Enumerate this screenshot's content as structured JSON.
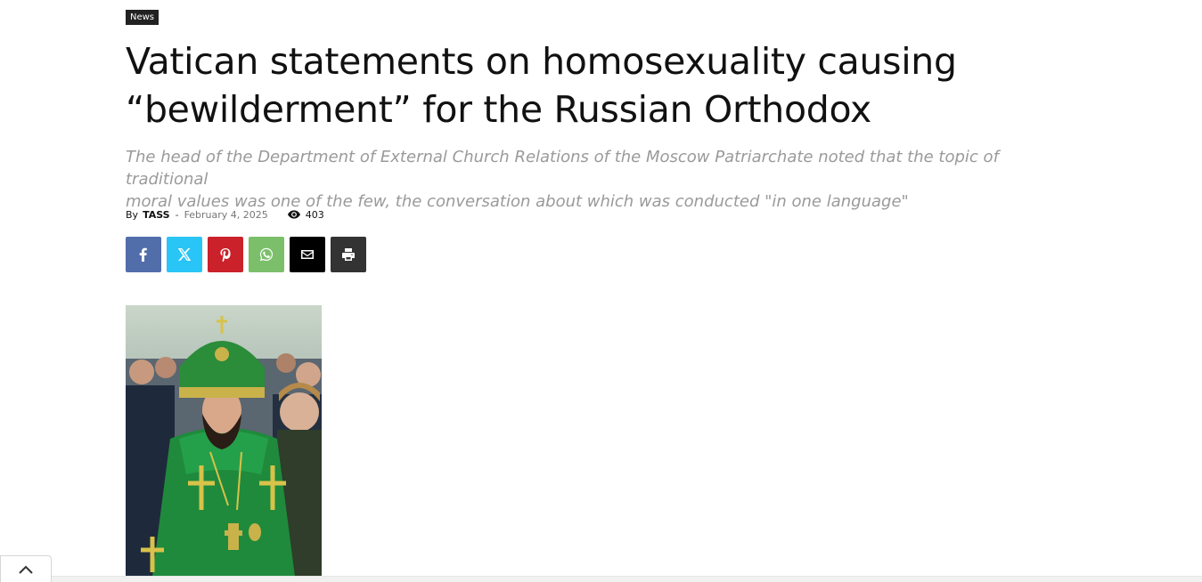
{
  "article": {
    "category": "News",
    "title_line1": "Vatican statements on homosexuality causing",
    "title_line2": "“bewilderment” for the Russian Orthodox",
    "subtitle_line1": "The head of the Department of External Church Relations of the Moscow Patriarchate noted that the topic of traditional",
    "subtitle_line2": "moral values was one of the few, the conversation about which was conducted \"in one language\"",
    "by_label": "By",
    "author": "TASS",
    "separator": "-",
    "date": "February 4, 2025",
    "views": "403"
  },
  "share_buttons": [
    {
      "name": "facebook",
      "icon": "facebook-icon",
      "color": "#516eab"
    },
    {
      "name": "twitter",
      "icon": "x-icon",
      "color": "#29c5f6"
    },
    {
      "name": "pinterest",
      "icon": "pinterest-icon",
      "color": "#ca212a"
    },
    {
      "name": "whatsapp",
      "icon": "whatsapp-icon",
      "color": "#7bbf6a"
    },
    {
      "name": "email",
      "icon": "envelope-icon",
      "color": "#000000"
    },
    {
      "name": "print",
      "icon": "printer-icon",
      "color": "#333333"
    }
  ],
  "image": {
    "subject": "Orthodox bishop in green vestments"
  },
  "scroll_top": {
    "icon": "chevron-up-icon"
  }
}
